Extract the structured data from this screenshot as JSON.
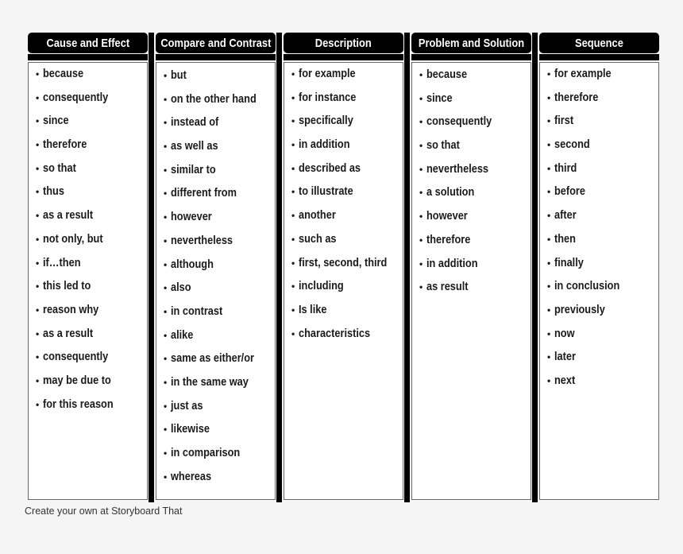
{
  "footer": {
    "text": "Create your own at Storyboard That"
  },
  "bullet_glyph": "•",
  "columns": [
    {
      "title": "Cause and Effect",
      "items": [
        "because",
        "consequently",
        "since",
        "therefore",
        "so that",
        "thus",
        "as a result",
        "not only, but",
        "if…then",
        "this led to",
        "reason why",
        "as a result",
        "consequently",
        "may be due to",
        "for this reason"
      ]
    },
    {
      "title": "Compare and Contrast",
      "items": [
        "but",
        "on the other hand",
        "instead of",
        "as well as",
        "similar to",
        "different from",
        "however",
        "nevertheless",
        "although",
        "also",
        "in contrast",
        "alike",
        "same as either/or",
        "in the same way",
        "just as",
        "likewise",
        "in comparison",
        "whereas"
      ]
    },
    {
      "title": "Description",
      "items": [
        "for example",
        "for instance",
        "specifically",
        "in addition",
        "described as",
        "to illustrate",
        "another",
        "such as",
        "first, second, third",
        "including",
        "Is like",
        "characteristics"
      ]
    },
    {
      "title": "Problem and Solution",
      "items": [
        "because",
        "since",
        "consequently",
        "so that",
        "nevertheless",
        "a solution",
        "however",
        "therefore",
        "in addition",
        "as result"
      ]
    },
    {
      "title": "Sequence",
      "items": [
        "for example",
        "therefore",
        "first",
        "second",
        "third",
        "before",
        "after",
        "then",
        "finally",
        "in conclusion",
        "previously",
        "now",
        "later",
        "next"
      ]
    }
  ]
}
